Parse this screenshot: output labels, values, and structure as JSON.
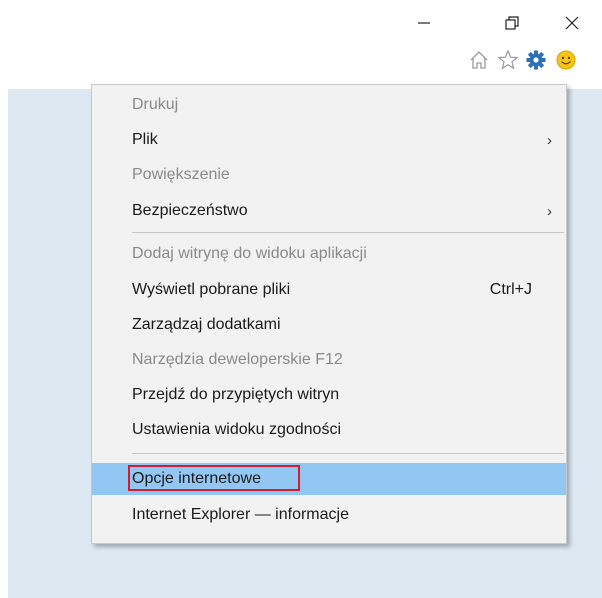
{
  "window_controls": {
    "minimize_glyph": "—",
    "restore_glyph": "❐",
    "close_glyph": "✕"
  },
  "toolbar": {
    "icons": [
      "home-icon",
      "favorites-star-icon",
      "tools-gear-icon",
      "feedback-smiley-icon"
    ],
    "gear_color": "#2b6fb8",
    "smiley_color": "#f5c518"
  },
  "menu": {
    "items": [
      {
        "label": "Drukuj",
        "disabled": true,
        "submenu": false
      },
      {
        "label": "Plik",
        "disabled": false,
        "submenu": true
      },
      {
        "label": "Powiększenie",
        "disabled": true,
        "submenu": false
      },
      {
        "label": "Bezpieczeństwo",
        "disabled": false,
        "submenu": true
      },
      {
        "label": "Dodaj witrynę do widoku aplikacji",
        "disabled": true,
        "submenu": false
      },
      {
        "label": "Wyświetl pobrane pliki",
        "disabled": false,
        "submenu": false,
        "shortcut": "Ctrl+J"
      },
      {
        "label": "Zarządzaj dodatkami",
        "disabled": false,
        "submenu": false
      },
      {
        "label": "Narzędzia deweloperskie F12",
        "disabled": true,
        "submenu": false
      },
      {
        "label": "Przejdź do przypiętych witryn",
        "disabled": false,
        "submenu": false
      },
      {
        "label": "Ustawienia widoku zgodności",
        "disabled": false,
        "submenu": false
      },
      {
        "label": "Opcje internetowe",
        "disabled": false,
        "submenu": false,
        "highlighted": true
      },
      {
        "label": "Internet Explorer — informacje",
        "disabled": false,
        "submenu": false
      }
    ],
    "submenu_arrow": "›",
    "highlight_color": "#92c7f4",
    "annotation_color": "#d51c2c"
  }
}
